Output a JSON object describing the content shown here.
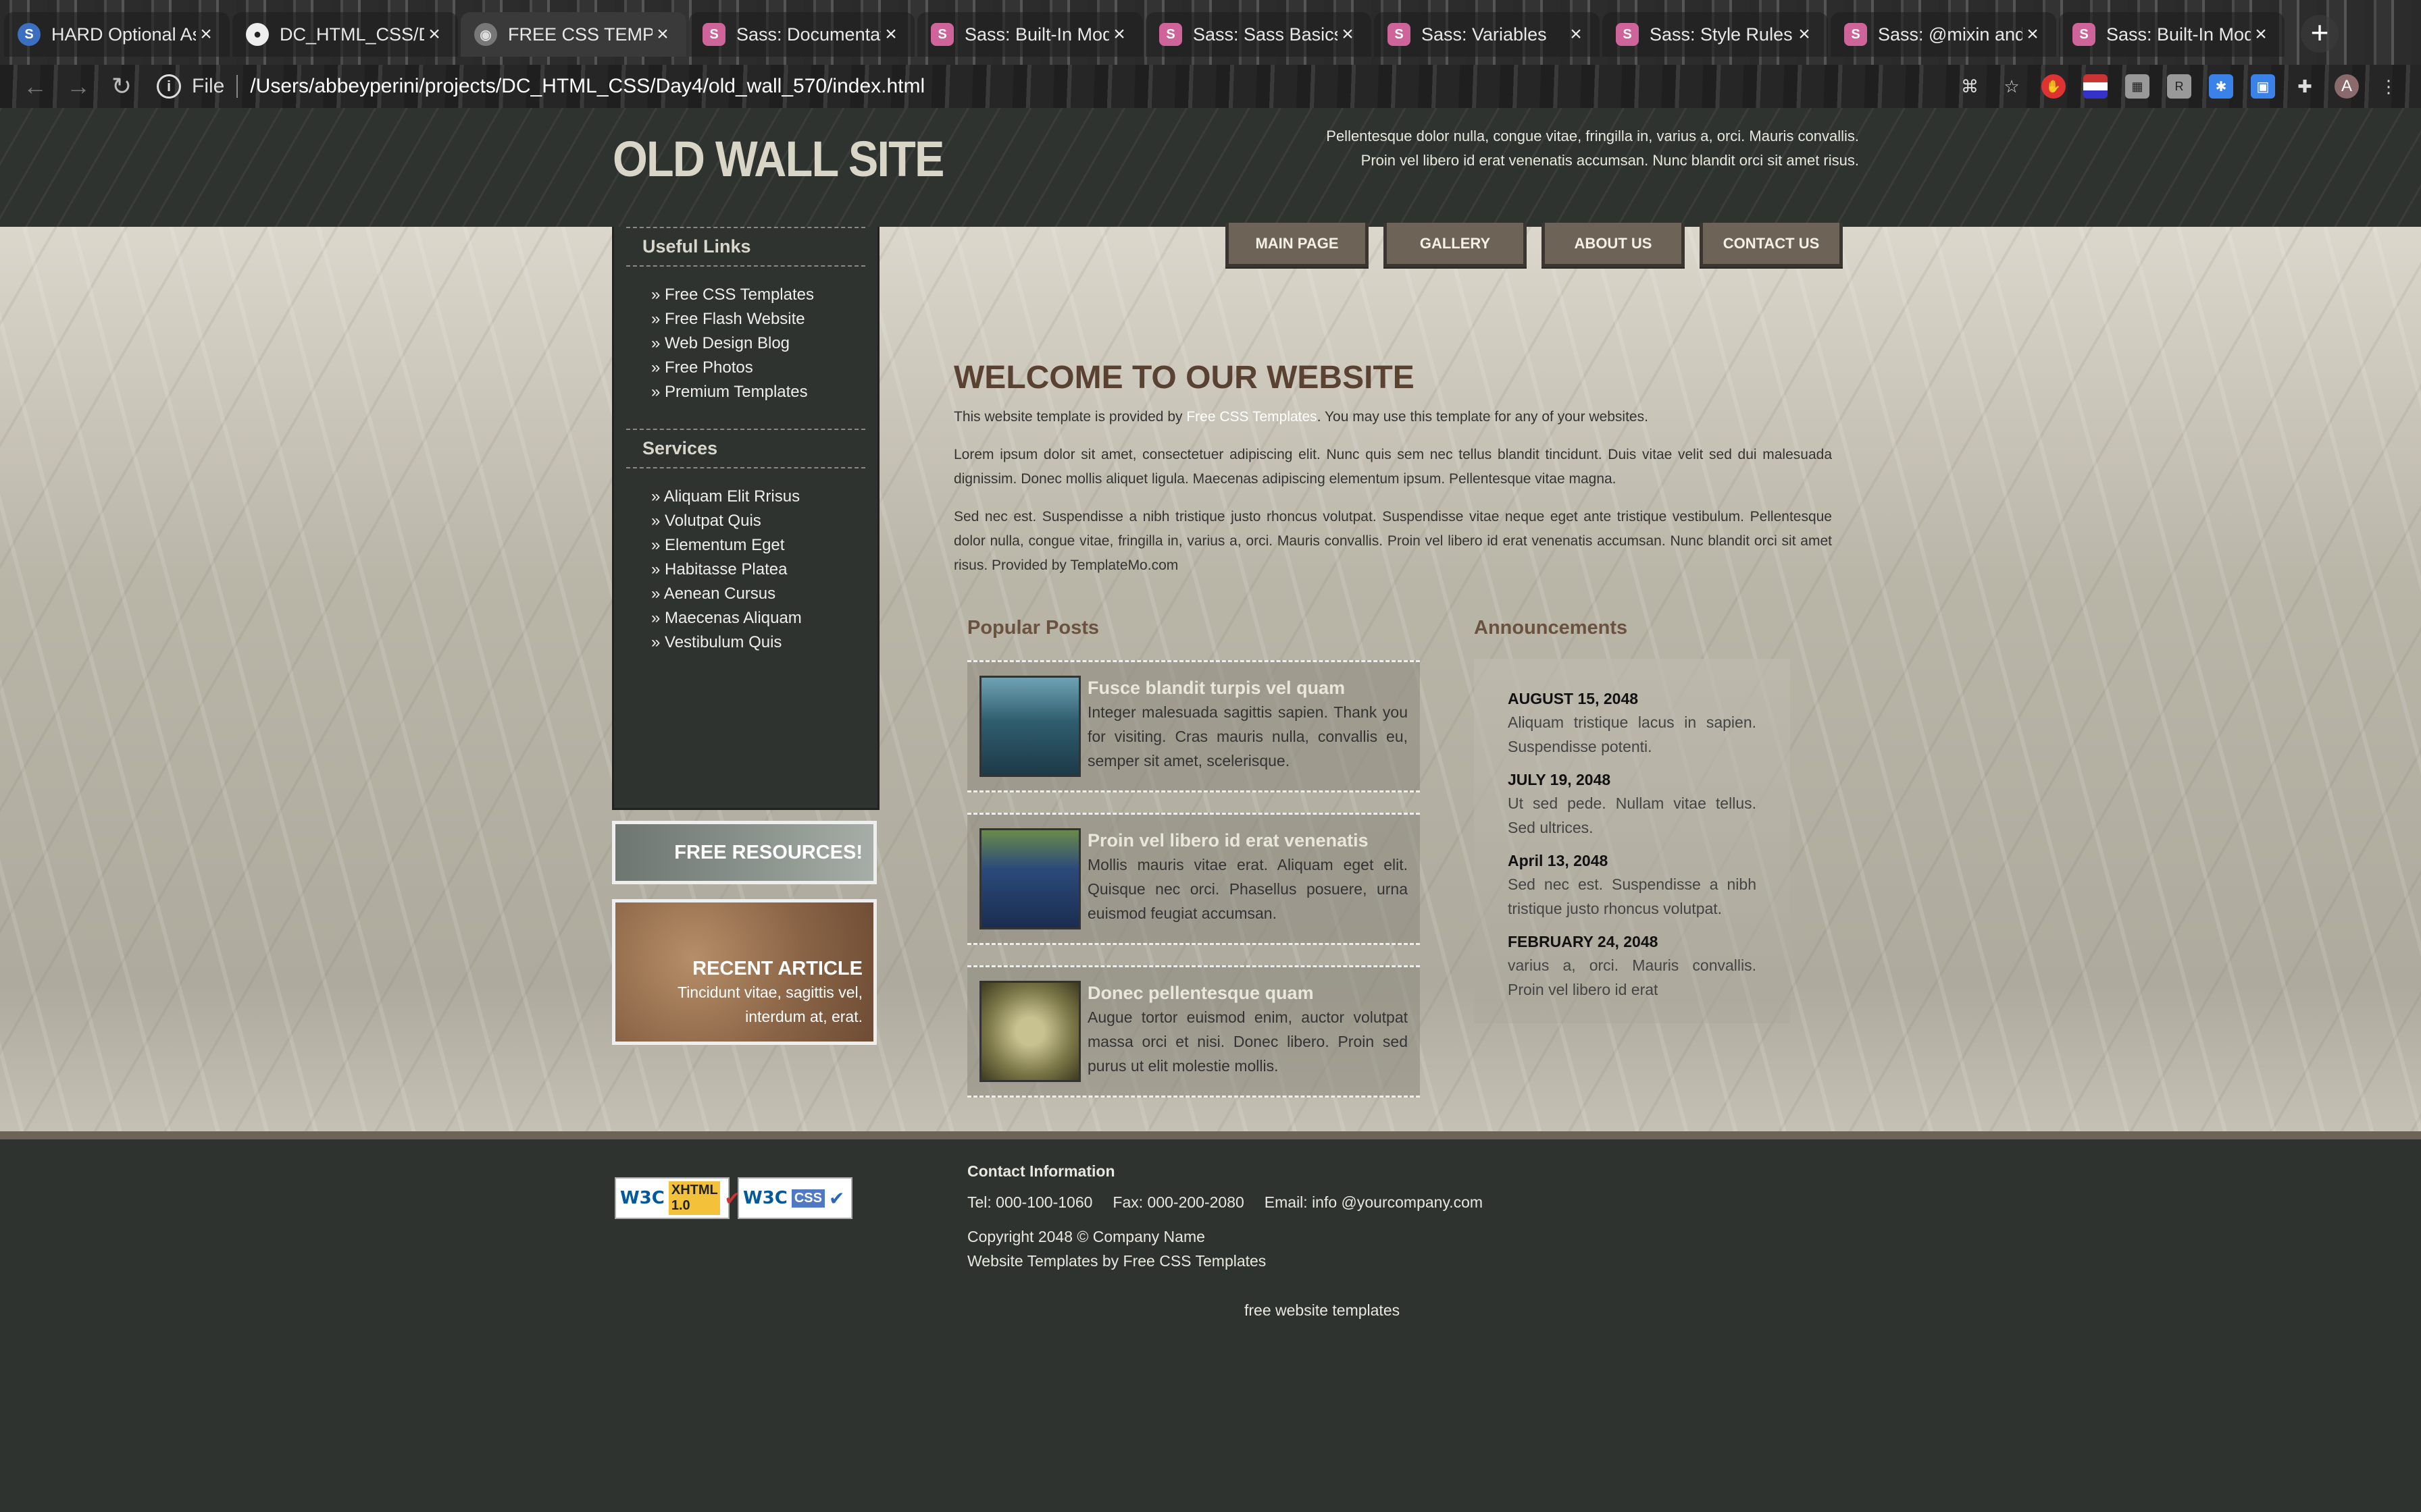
{
  "browser": {
    "tabs": [
      {
        "title": "HARD Optional As",
        "favicon": "S"
      },
      {
        "title": "DC_HTML_CSS/Da",
        "favicon": "github"
      },
      {
        "title": "FREE CSS TEMPL",
        "favicon": "page",
        "active": true
      },
      {
        "title": "Sass: Documentat",
        "favicon": "sass"
      },
      {
        "title": "Sass: Built-In Mod",
        "favicon": "sass"
      },
      {
        "title": "Sass: Sass Basics",
        "favicon": "sass"
      },
      {
        "title": "Sass: Variables",
        "favicon": "sass"
      },
      {
        "title": "Sass: Style Rules",
        "favicon": "sass"
      },
      {
        "title": "Sass: @mixin and",
        "favicon": "sass"
      },
      {
        "title": "Sass: Built-In Mod",
        "favicon": "sass"
      }
    ],
    "scheme_label": "File",
    "url": "/Users/abbeyperini/projects/DC_HTML_CSS/Day4/old_wall_570/index.html",
    "avatar_letter": "A"
  },
  "site": {
    "logo": "OLD WALL SITE",
    "header_text": "Pellentesque dolor nulla, congue vitae, fringilla in, varius a, orci. Mauris convallis. Proin vel libero id erat venenatis accumsan. Nunc blandit orci sit amet risus.",
    "nav": [
      "MAIN PAGE",
      "GALLERY",
      "ABOUT US",
      "CONTACT US"
    ],
    "sidebar": {
      "useful_links_title": "Useful Links",
      "useful_links": [
        "Free CSS Templates",
        "Free Flash Website",
        "Web Design Blog",
        "Free Photos",
        "Premium Templates"
      ],
      "services_title": "Services",
      "services": [
        "Aliquam Elit Rrisus",
        "Volutpat Quis",
        "Elementum Eget",
        "Habitasse Platea",
        "Aenean Cursus",
        "Maecenas Aliquam",
        "Vestibulum Quis"
      ],
      "free_resources": "FREE RESOURCES!",
      "recent_title": "RECENT ARTICLE",
      "recent_text": "Tincidunt vitae, sagittis vel, interdum at, erat."
    },
    "welcome": {
      "title": "WELCOME TO OUR WEBSITE",
      "intro_before": "This website template is provided by ",
      "intro_link": "Free CSS Templates",
      "intro_after": ". You may use this template for any of your websites.",
      "p2": "Lorem ipsum dolor sit amet, consectetuer adipiscing elit. Nunc quis sem nec tellus blandit tincidunt. Duis vitae velit sed dui malesuada dignissim. Donec mollis aliquet ligula. Maecenas adipiscing elementum ipsum. Pellentesque vitae magna.",
      "p3": "Sed nec est. Suspendisse a nibh tristique justo rhoncus volutpat. Suspendisse vitae neque eget ante tristique vestibulum. Pellentesque dolor nulla, congue vitae, fringilla in, varius a, orci. Mauris convallis. Proin vel libero id erat venenatis accumsan. Nunc blandit orci sit amet risus. Provided by TemplateMo.com"
    },
    "popular_posts": {
      "title": "Popular Posts",
      "items": [
        {
          "title": "Fusce blandit turpis vel quam",
          "text": "Integer malesuada sagittis sapien. Thank you for visiting. Cras mauris nulla, convallis eu, semper sit amet, scelerisque."
        },
        {
          "title": "Proin vel libero id erat venenatis",
          "text": "Mollis mauris vitae erat. Aliquam eget elit. Quisque nec orci. Phasellus posuere, urna euismod feugiat accumsan."
        },
        {
          "title": "Donec pellentesque quam",
          "text": "Augue tortor euismod enim, auctor volutpat massa orci et nisi. Donec libero. Proin sed purus ut elit molestie mollis."
        }
      ]
    },
    "announcements": {
      "title": "Announcements",
      "items": [
        {
          "date": "AUGUST 15, 2048",
          "text": "Aliquam tristique lacus in sapien. Suspendisse potenti."
        },
        {
          "date": "JULY 19, 2048",
          "text": "Ut sed pede. Nullam vitae tellus. Sed ultrices."
        },
        {
          "date": "April 13, 2048",
          "text": "Sed nec est. Suspendisse a nibh tristique justo rhoncus volutpat."
        },
        {
          "date": "FEBRUARY 24, 2048",
          "text": "varius a, orci. Mauris convallis. Proin vel libero id erat"
        }
      ]
    },
    "footer": {
      "badge_xhtml": "XHTML 1.0",
      "badge_css": "CSS",
      "badge_w3c": "W3C",
      "contact_title": "Contact Information",
      "tel": "Tel: 000-100-1060",
      "fax": "Fax: 000-200-2080",
      "email": "Email: info @yourcompany.com",
      "copyright": "Copyright 2048 © Company Name",
      "credits": "Website Templates by Free CSS Templates",
      "link": "free website templates"
    }
  }
}
